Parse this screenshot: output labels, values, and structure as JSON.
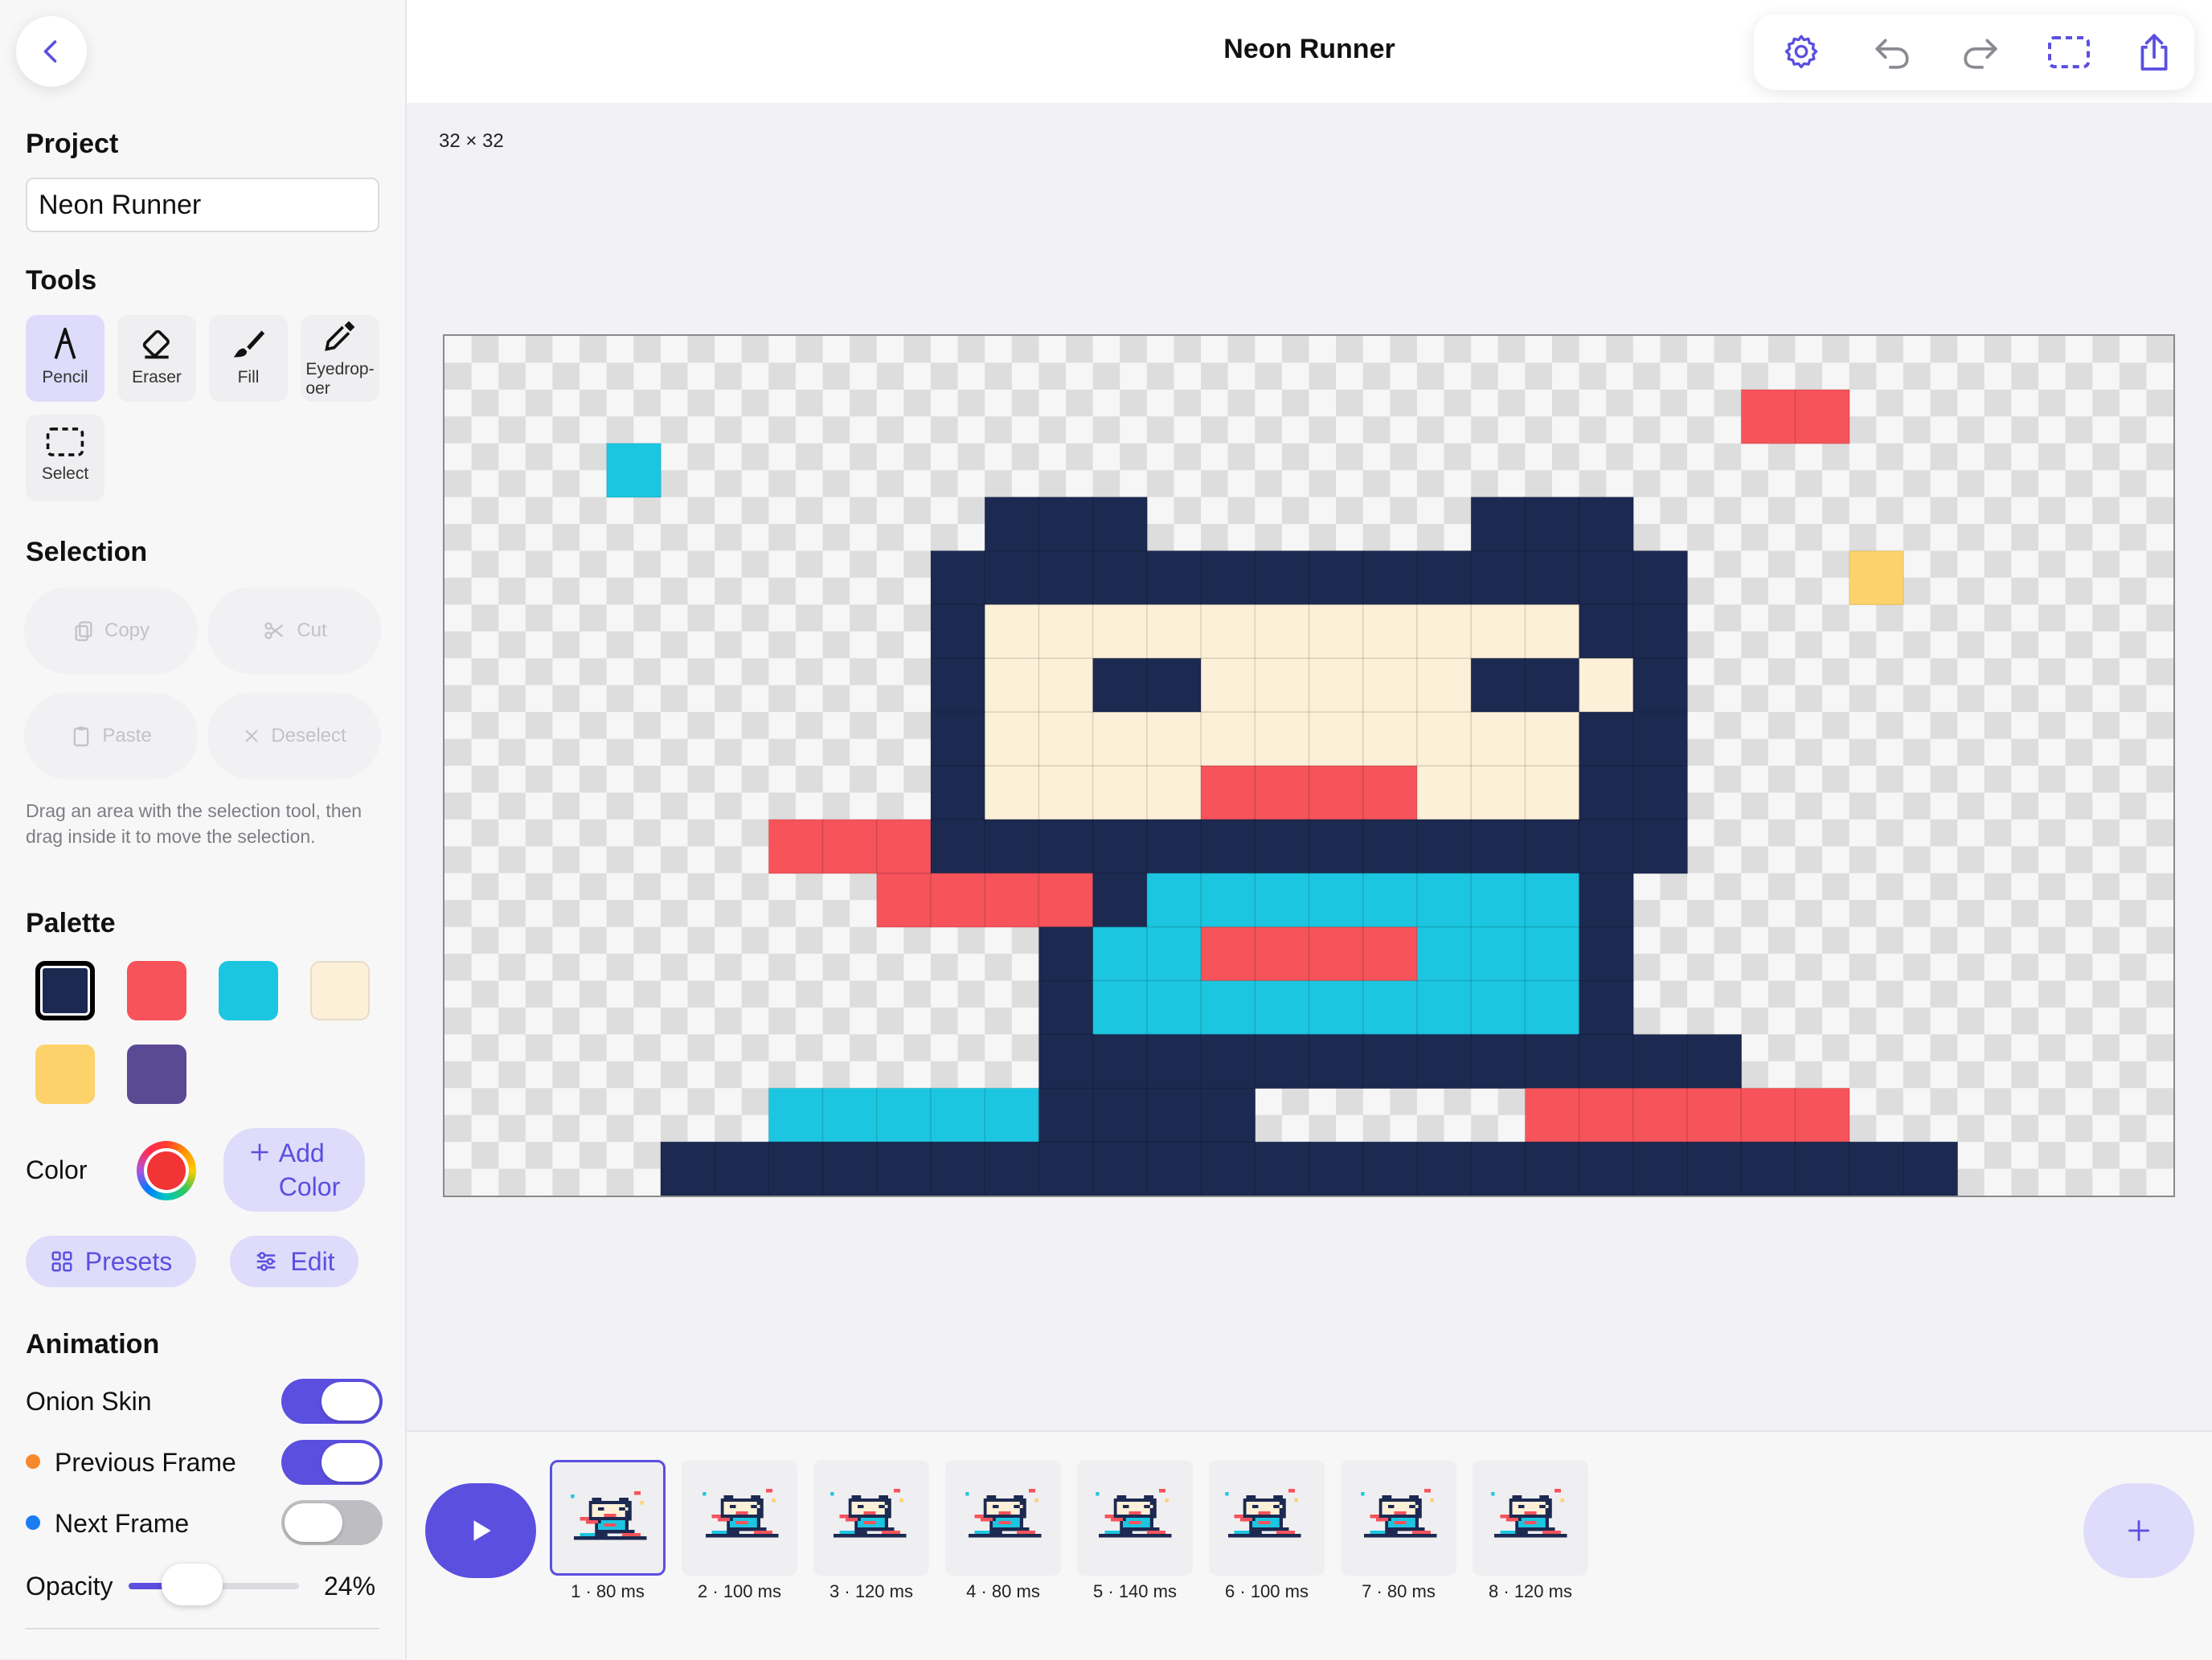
{
  "app": {
    "title": "Neon Runner",
    "canvas_size_label": "32 × 32"
  },
  "sidebar": {
    "project": {
      "heading": "Project",
      "name_value": "Neon Runner"
    },
    "tools": {
      "heading": "Tools",
      "items": [
        {
          "label": "Pencil",
          "icon": "pencil-icon",
          "active": true
        },
        {
          "label": "Eraser",
          "icon": "eraser-icon",
          "active": false
        },
        {
          "label": "Fill",
          "icon": "brush-icon",
          "active": false
        },
        {
          "label": "Eyedrop-\noer",
          "icon": "eyedropper-icon",
          "active": false
        },
        {
          "label": "Select",
          "icon": "select-icon",
          "active": false
        }
      ]
    },
    "selection": {
      "heading": "Selection",
      "copy": "Copy",
      "cut": "Cut",
      "paste": "Paste",
      "deselect": "Deselect",
      "help": "Drag an area with the selection tool, then drag inside it to move the selection."
    },
    "palette": {
      "heading": "Palette",
      "colors": [
        "#1c2951",
        "#f6535b",
        "#1cc6e0",
        "#fdf0d8",
        "#fdd26b",
        "#5a4a93"
      ],
      "selected_index": 0
    },
    "color": {
      "label": "Color",
      "current": "#f13434",
      "add_label_1": "Add",
      "add_label_2": "Color"
    },
    "presets_label": "Presets",
    "edit_label": "Edit",
    "animation": {
      "heading": "Animation",
      "onion_skin": {
        "label": "Onion Skin",
        "on": true
      },
      "previous_frame": {
        "label": "Previous Frame",
        "on": true,
        "dot_color": "#f5892b"
      },
      "next_frame": {
        "label": "Next Frame",
        "on": false,
        "dot_color": "#1a7ef2"
      },
      "opacity": {
        "label": "Opacity",
        "value": 0.24,
        "value_label": "24%"
      }
    }
  },
  "toolbar": {
    "buttons": [
      "gear-icon",
      "undo-icon",
      "redo-icon",
      "selection-icon",
      "share-icon"
    ]
  },
  "canvas": {
    "columns": 32,
    "rows": 16,
    "checker_light": "#f6f6f6",
    "checker_dark": "#dddddd",
    "colors": {
      "N": "#1c2951",
      "R": "#f6535b",
      "C": "#1cc6e0",
      "F": "#fdf0d8",
      "Y": "#fdd26b"
    },
    "pixels": [
      "................................",
      "........................RR......",
      "...C............................",
      "..........NNN......NNN..........",
      ".........NNNNNNNNNNNNNN...Y.....",
      ".........NFFFFFFFFFFFNN.........",
      ".........NFFNNFFFFFNNFN.........",
      ".........NFFFFFFFFFFFNN.........",
      ".........NFFFFRRRRFFFNN.........",
      "......RRRNNNNNNNNNNNNNN.........",
      "........RRRRNCCCCCCCCN..........",
      "...........NCCRRRRCCCN..........",
      "...........NCCCCCCCCCN..........",
      "...........NNNNNNNNNNNNN........",
      "......CCCCCNNNN.....RRRRRR......",
      "....NNNNNNNNNNNNNNNNNNNNNNNN...."
    ]
  },
  "timeline": {
    "frames": [
      {
        "label": "1 · 80 ms",
        "selected": true
      },
      {
        "label": "2 · 100 ms",
        "selected": false
      },
      {
        "label": "3 · 120 ms",
        "selected": false
      },
      {
        "label": "4 · 80 ms",
        "selected": false
      },
      {
        "label": "5 · 140 ms",
        "selected": false
      },
      {
        "label": "6 · 100 ms",
        "selected": false
      },
      {
        "label": "7 · 80 ms",
        "selected": false
      },
      {
        "label": "8 · 120 ms",
        "selected": false
      }
    ],
    "play_icon": "play-icon",
    "add_icon": "plus-icon"
  }
}
